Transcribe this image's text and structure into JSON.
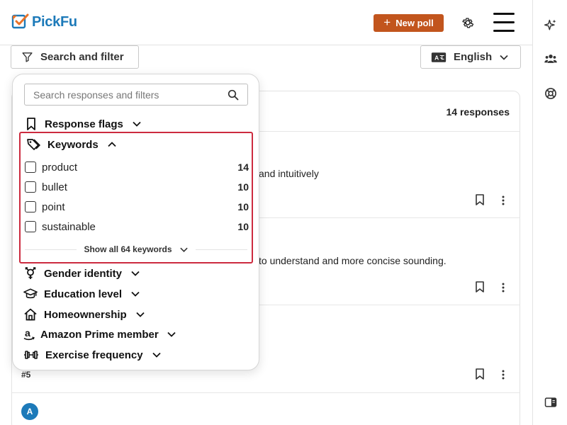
{
  "brand": {
    "name": "PickFu",
    "color": "#1d7ab9"
  },
  "header": {
    "new_poll_label": "New poll",
    "accent": "#c2551d"
  },
  "filter_bar": {
    "search_filter_label": "Search and filter",
    "language_label": "English"
  },
  "results": {
    "count_label": "14 responses",
    "snippets": [
      "and intuitively",
      "to understand and more concise sounding."
    ],
    "row_number": "#5",
    "avatar_letter": "A"
  },
  "popup": {
    "search_placeholder": "Search responses and filters",
    "sections_top": [
      {
        "label": "Response flags",
        "icon": "bookmark-icon"
      }
    ],
    "keywords": {
      "label": "Keywords",
      "highlight_color": "#cc2b3f",
      "items": [
        {
          "label": "product",
          "count": "14"
        },
        {
          "label": "bullet",
          "count": "10"
        },
        {
          "label": "point",
          "count": "10"
        },
        {
          "label": "sustainable",
          "count": "10"
        }
      ],
      "show_all_label": "Show all 64 keywords"
    },
    "sections_bottom": [
      {
        "label": "Gender identity",
        "icon": "gender-icon"
      },
      {
        "label": "Education level",
        "icon": "graduation-cap-icon"
      },
      {
        "label": "Homeownership",
        "icon": "house-icon"
      },
      {
        "label": "Amazon Prime member",
        "icon": "amazon-icon"
      },
      {
        "label": "Exercise frequency",
        "icon": "dumbbell-icon"
      }
    ]
  }
}
